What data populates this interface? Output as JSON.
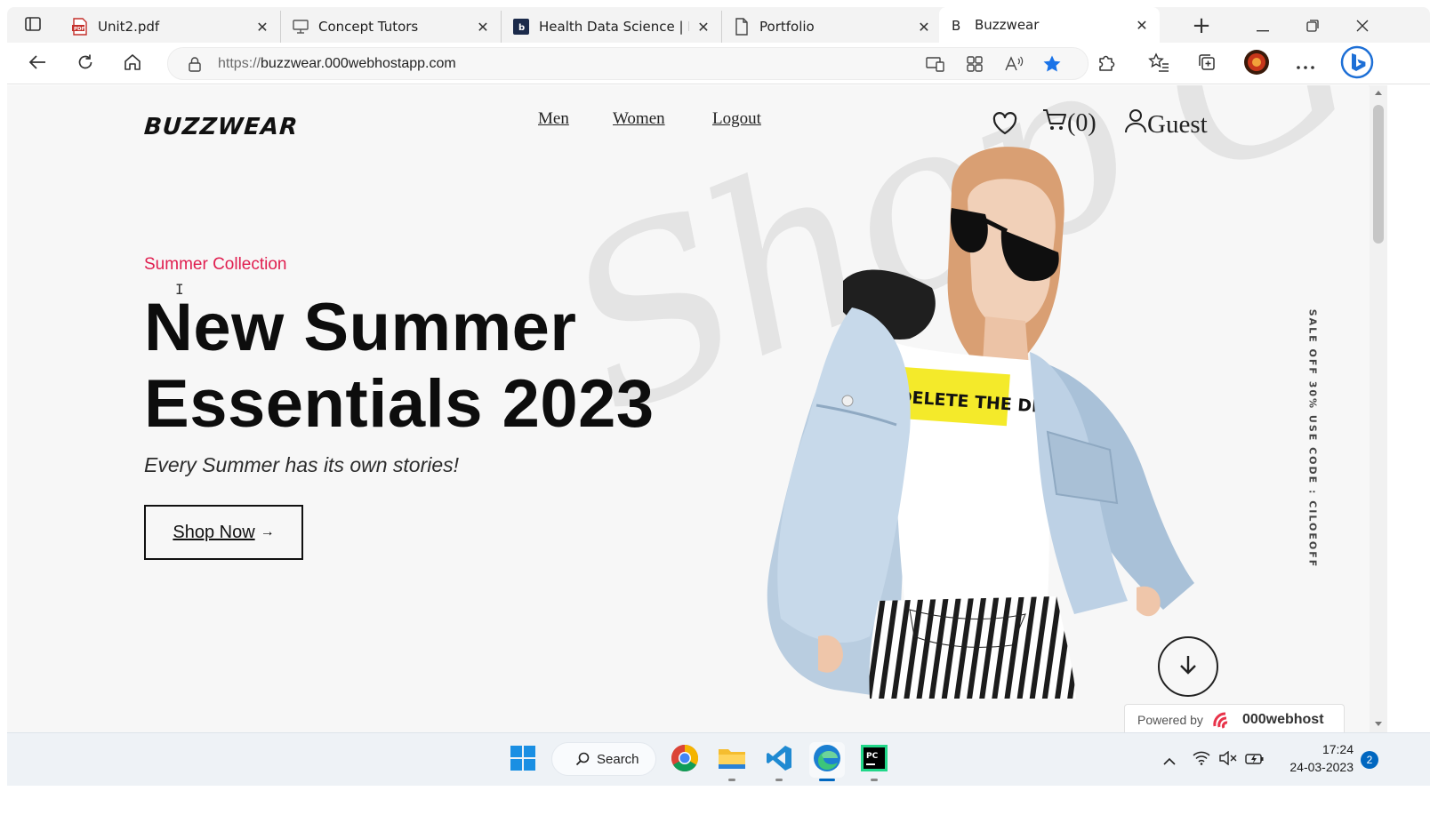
{
  "browser": {
    "tabs": [
      {
        "label": "Unit2.pdf",
        "icon": "pdf-icon",
        "active": false
      },
      {
        "label": "Concept Tutors",
        "icon": "monitor-icon",
        "active": false
      },
      {
        "label": "Health Data Science | Basy",
        "icon": "b-badge-icon",
        "active": false
      },
      {
        "label": "Portfolio",
        "icon": "document-icon",
        "active": false
      },
      {
        "label": "Buzzwear",
        "icon": "letter-b-icon",
        "active": true
      }
    ],
    "new_tab_label": "+",
    "close_glyph": "✕",
    "address": {
      "scheme": "https://",
      "host": "buzzwear.000webhostapp.com"
    },
    "favorite_color": "#1a73e8"
  },
  "site": {
    "logo": "BUZZWEAR",
    "nav": {
      "men": "Men",
      "women": "Women",
      "logout": "Logout"
    },
    "cart_count": "(0)",
    "user_label": "Guest",
    "hero": {
      "kicker": "Summer Collection",
      "title_line1": "New Summer",
      "title_line2": "Essentials 2023",
      "subtitle": "Every Summer has its own stories!",
      "cta_label": "Shop Now",
      "cta_arrow": "→"
    },
    "side_promo": "SALE OFF 30% USE CODE : CILOEOFF",
    "watermark_text": "Shop Girls",
    "tshirt_print": "DELETE THE DRAM",
    "powered_by": "Powered by",
    "powered_brand": "000webhost",
    "accent_color": "#e01e4f"
  },
  "taskbar": {
    "search_label": "Search",
    "apps": [
      "start-icon",
      "chrome-icon",
      "file-explorer-icon",
      "vscode-icon",
      "edge-icon",
      "pycharm-icon"
    ],
    "time": "17:24",
    "date": "24-03-2023",
    "notification_count": "2"
  }
}
